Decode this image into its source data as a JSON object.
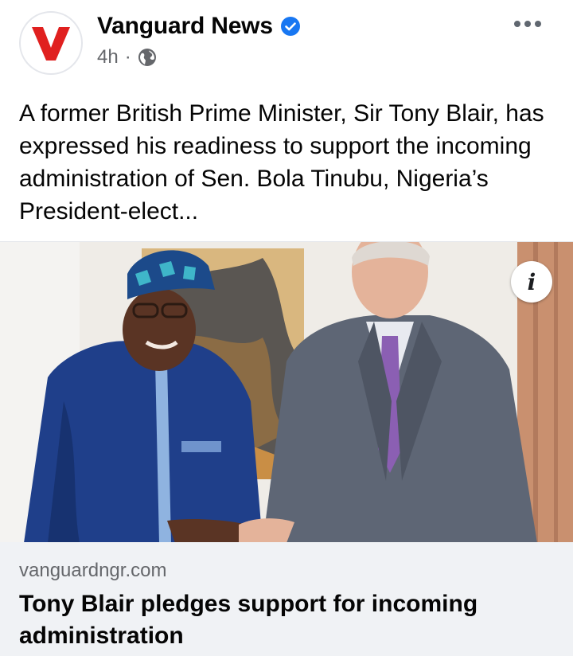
{
  "post": {
    "page_name": "Vanguard News",
    "time": "4h",
    "separator": "·",
    "caption": "A former British Prime Minister, Sir Tony Blair, has expressed his readiness to support the incoming administration of Sen. Bola Tinubu, Nigeria’s President-elect...",
    "avatar_letter": "V",
    "icons": [
      "verified-icon",
      "globe-icon",
      "more-options-icon",
      "info-icon"
    ],
    "colors": {
      "verified": "#1877f2",
      "brand_red": "#e0201f",
      "meta": "#65676b",
      "card_bg": "#f0f2f5"
    }
  },
  "media": {
    "info_label": "i",
    "description_hidden": ""
  },
  "link_preview": {
    "domain": "vanguardngr.com",
    "title": "Tony Blair pledges support for incoming administration"
  }
}
